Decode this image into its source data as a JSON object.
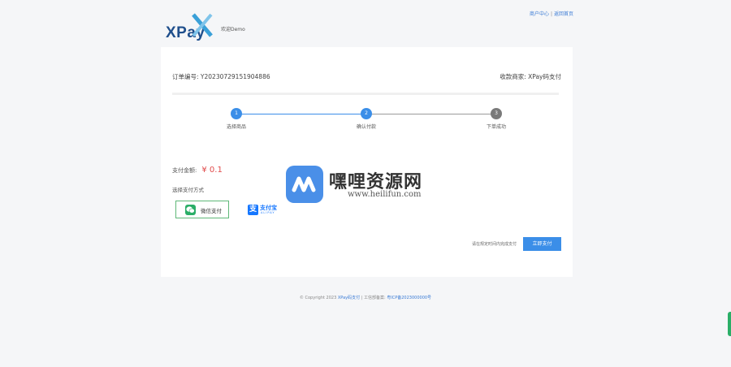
{
  "header": {
    "logo_text": "XPay",
    "welcome": "欢迎Demo",
    "links": [
      {
        "label": "商户中心"
      },
      {
        "label": "返回首页"
      }
    ]
  },
  "order": {
    "order_label": "订单编号:",
    "order_no": "Y20230729151904886",
    "merchant_label": "收款商家:",
    "merchant_name": "XPay码支付"
  },
  "steps": [
    {
      "num": "1",
      "label": "选择商品",
      "state": "done",
      "color": "#3b8ee8"
    },
    {
      "num": "2",
      "label": "确认付款",
      "state": "active",
      "color": "#3b8ee8"
    },
    {
      "num": "3",
      "label": "下单成功",
      "state": "pending",
      "color": "#7a7a7a"
    }
  ],
  "payment": {
    "amount_label": "支付金额:",
    "amount": "¥ 0.1",
    "method_title": "选择支付方式",
    "methods": [
      {
        "label": "微信支付",
        "icon": "wechat-icon",
        "selected": true
      },
      {
        "label": "支付宝",
        "sub": "ALIPAY",
        "icon": "alipay-icon",
        "selected": false
      }
    ],
    "notice": "请在规定时间内完成支付",
    "pay_button": "立即支付"
  },
  "footer": {
    "copyright": "© Copyright 2023",
    "brand": "XPay码支付",
    "sep": " | ",
    "icp_label": "工信部备案:",
    "icp": "粤ICP备2023000000号"
  },
  "watermark": {
    "title": "嘿哩资源网",
    "url": "www.heilifun.com"
  },
  "colors": {
    "accent": "#3b8ee8",
    "amount_red": "#e14b4b",
    "wechat_green": "#2aae67",
    "alipay_blue": "#1677ff"
  }
}
